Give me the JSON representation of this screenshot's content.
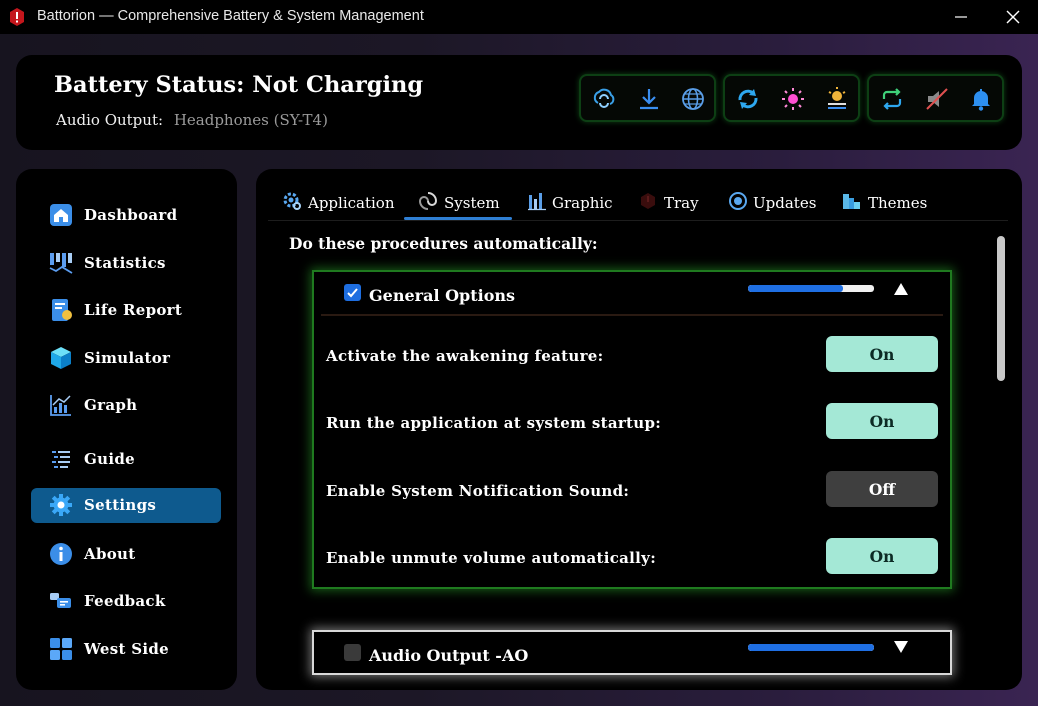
{
  "window": {
    "title": "Battorion — Comprehensive Battery & System Management",
    "minimize_icon": "minimize-icon",
    "close_icon": "close-icon"
  },
  "header": {
    "status_title": "Battery Status: Not Charging",
    "audio_label": "Audio Output:",
    "audio_value": "Headphones (SY-T4)",
    "toolbar_groups": [
      [
        "sync-cloud-icon",
        "download-icon",
        "globe-icon"
      ],
      [
        "refresh-link-icon",
        "brightness-icon",
        "equalizer-icon"
      ],
      [
        "repeat-icon",
        "mute-speaker-icon",
        "bell-icon"
      ]
    ]
  },
  "sidebar": {
    "items": [
      {
        "label": "Dashboard",
        "icon": "home-icon"
      },
      {
        "label": "Statistics",
        "icon": "statistics-icon"
      },
      {
        "label": "Life Report",
        "icon": "report-icon"
      },
      {
        "label": "Simulator",
        "icon": "cube-icon"
      },
      {
        "label": "Graph",
        "icon": "graph-icon"
      },
      {
        "label": "Guide",
        "icon": "guide-icon"
      },
      {
        "label": "Settings",
        "icon": "gear-icon",
        "active": true
      },
      {
        "label": "About",
        "icon": "info-icon"
      },
      {
        "label": "Feedback",
        "icon": "feedback-icon"
      },
      {
        "label": "West Side",
        "icon": "windows-icon"
      }
    ]
  },
  "tabs": [
    {
      "label": "Application",
      "icon": "app-gear-icon"
    },
    {
      "label": "System",
      "icon": "system-swirl-icon",
      "active": true
    },
    {
      "label": "Graphic",
      "icon": "bar-graph-icon"
    },
    {
      "label": "Tray",
      "icon": "tray-icon"
    },
    {
      "label": "Updates",
      "icon": "updates-icon"
    },
    {
      "label": "Themes",
      "icon": "themes-icon"
    }
  ],
  "main": {
    "heading": "Do these procedures automatically:",
    "general": {
      "title": "General Options",
      "checked": true,
      "progress": 0.75,
      "arrow": "collapse-arrow-icon",
      "settings": [
        {
          "label": "Activate the awakening feature:",
          "value": "On"
        },
        {
          "label": "Run the application at system startup:",
          "value": "On"
        },
        {
          "label": "Enable System Notification Sound:",
          "value": "Off"
        },
        {
          "label": "Enable unmute volume automatically:",
          "value": "On"
        }
      ]
    },
    "audio": {
      "title": "Audio Output -AO",
      "checked": false,
      "progress": 1.0,
      "arrow": "expand-arrow-icon"
    }
  },
  "colors": {
    "accent": "#0e5a8e",
    "toggle_on": "#a4e8d6",
    "toggle_off": "#3f3f3f",
    "progress": "#1f6fe3",
    "general_border": "#1f7a1f"
  }
}
